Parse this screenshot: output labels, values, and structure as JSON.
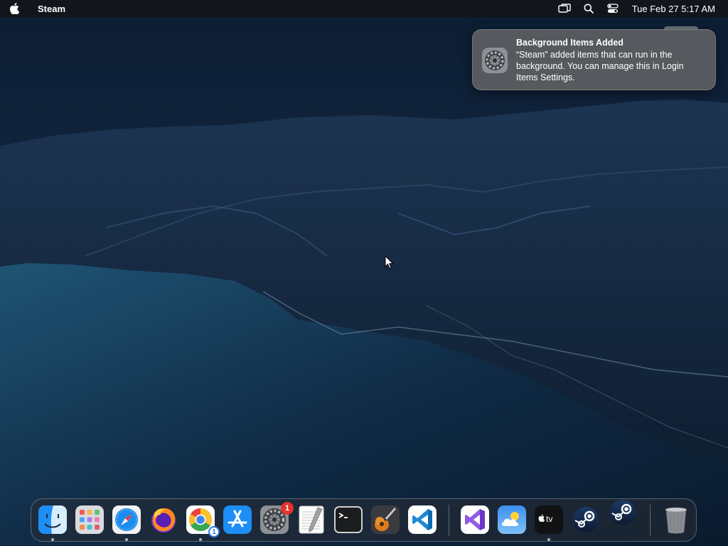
{
  "menubar": {
    "app_name": "Steam",
    "clock": "Tue Feb 27  5:17 AM",
    "icons": [
      "apple-icon",
      "screen-mirroring-icon",
      "spotlight-search-icon",
      "control-center-icon"
    ]
  },
  "notification": {
    "title": "Background Items Added",
    "body": "“Steam” added items that can run in the background. You can manage this in Login Items Settings.",
    "icon": "system-settings-icon"
  },
  "dock": {
    "items": [
      {
        "name": "finder",
        "running": true
      },
      {
        "name": "launchpad",
        "running": false
      },
      {
        "name": "safari",
        "running": true
      },
      {
        "name": "firefox",
        "running": false
      },
      {
        "name": "chrome",
        "running": true,
        "badge": "1"
      },
      {
        "name": "app-store",
        "running": false
      },
      {
        "name": "system-settings",
        "running": false,
        "badge": "1"
      },
      {
        "name": "textedit",
        "running": false
      },
      {
        "name": "terminal",
        "running": false
      },
      {
        "name": "garageband",
        "running": false
      },
      {
        "name": "vscode",
        "running": false
      },
      {
        "name": "visual-studio",
        "running": false
      },
      {
        "name": "weather",
        "running": false
      },
      {
        "name": "apple-tv",
        "running": true
      },
      {
        "name": "steam",
        "running": false
      },
      {
        "name": "steam-helper",
        "running": false
      },
      {
        "name": "trash",
        "running": false
      }
    ],
    "chrome_badge": "1",
    "settings_badge": "1",
    "tv_label": "tv"
  },
  "colors": {
    "menubar_bg": "#14161a",
    "badge_red": "#e5322d",
    "notification_bg": "#5c5e62"
  }
}
